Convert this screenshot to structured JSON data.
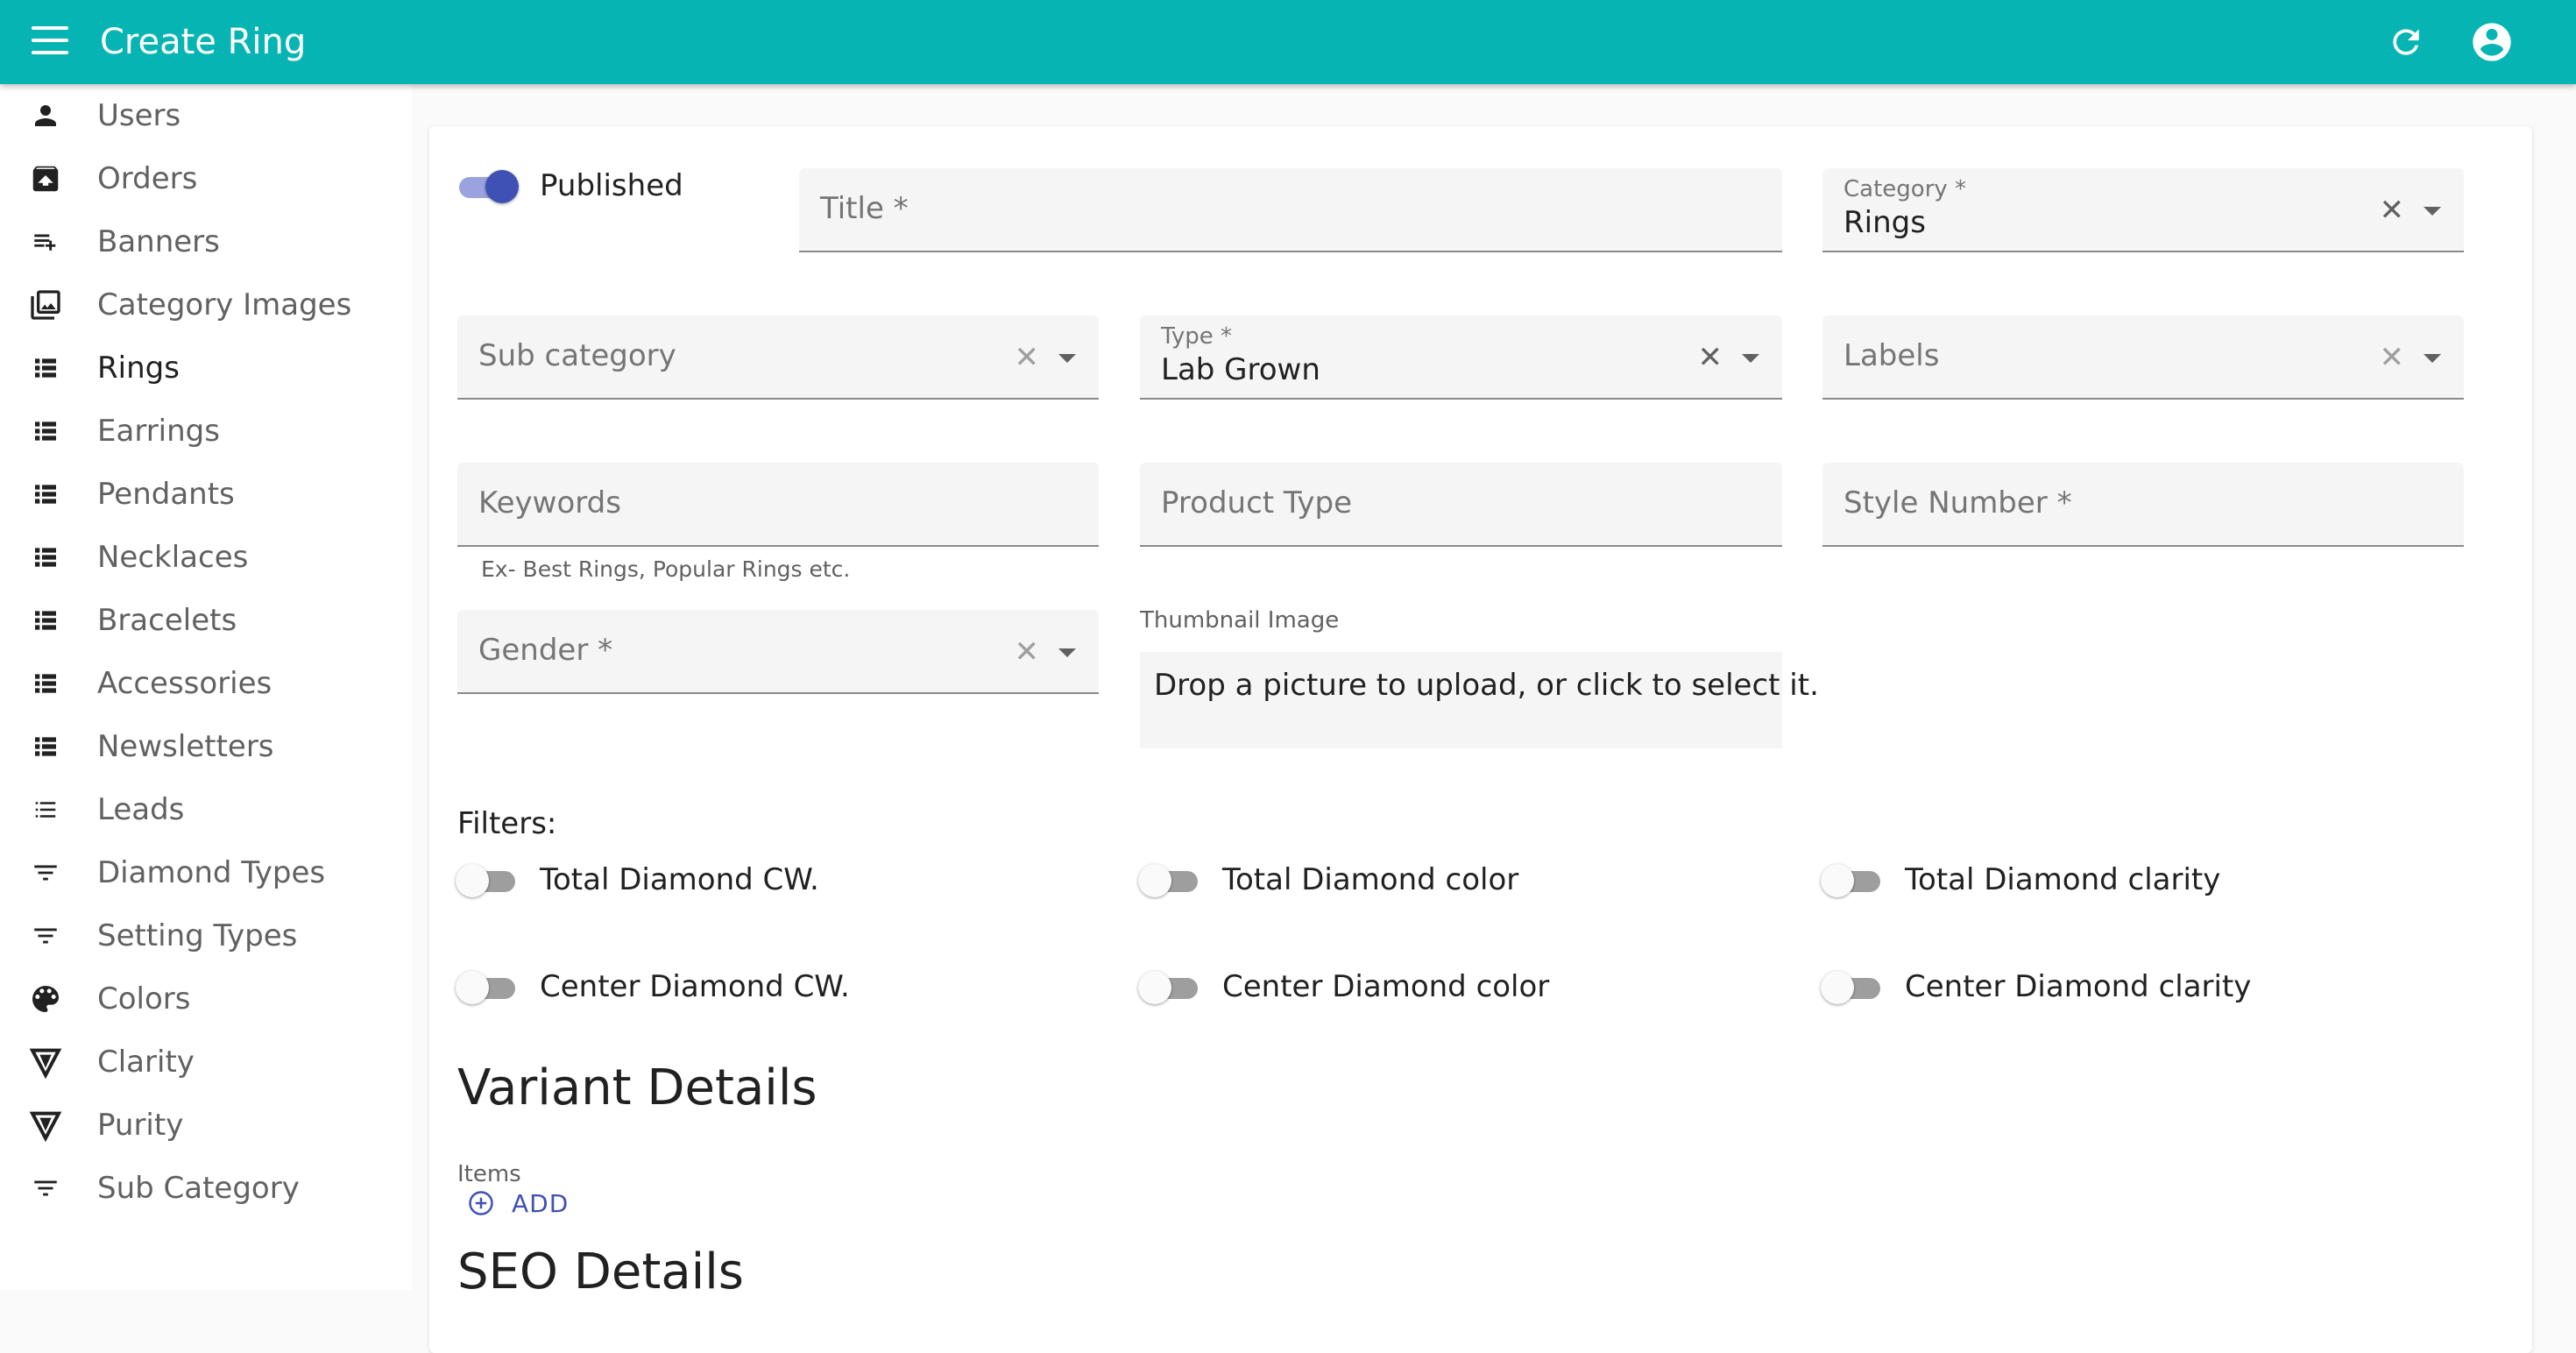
{
  "appbar": {
    "title": "Create Ring",
    "icons": [
      "menu-icon",
      "refresh-icon",
      "account-circle-icon"
    ],
    "color": "#06b5b3"
  },
  "sidebar": {
    "items": [
      {
        "label": "Users",
        "icon": "person-icon"
      },
      {
        "label": "Orders",
        "icon": "archive-icon"
      },
      {
        "label": "Banners",
        "icon": "playlist-add-icon"
      },
      {
        "label": "Category Images",
        "icon": "photo-library-icon"
      },
      {
        "label": "Rings",
        "icon": "view-list-icon",
        "active": true
      },
      {
        "label": "Earrings",
        "icon": "view-list-icon"
      },
      {
        "label": "Pendants",
        "icon": "view-list-icon"
      },
      {
        "label": "Necklaces",
        "icon": "view-list-icon"
      },
      {
        "label": "Bracelets",
        "icon": "view-list-icon"
      },
      {
        "label": "Accessories",
        "icon": "view-list-icon"
      },
      {
        "label": "Newsletters",
        "icon": "view-list-icon"
      },
      {
        "label": "Leads",
        "icon": "list-icon"
      },
      {
        "label": "Diamond Types",
        "icon": "filter-list-icon"
      },
      {
        "label": "Setting Types",
        "icon": "filter-list-icon"
      },
      {
        "label": "Colors",
        "icon": "palette-icon"
      },
      {
        "label": "Clarity",
        "icon": "vignette-triangle-icon"
      },
      {
        "label": "Purity",
        "icon": "vignette-triangle-icon"
      },
      {
        "label": "Sub Category",
        "icon": "filter-list-icon"
      }
    ]
  },
  "form": {
    "published": {
      "label": "Published",
      "on": true
    },
    "title": {
      "placeholder": "Title *"
    },
    "category": {
      "label": "Category *",
      "value": "Rings"
    },
    "sub_category": {
      "placeholder": "Sub category"
    },
    "type": {
      "label": "Type *",
      "value": "Lab Grown"
    },
    "labels": {
      "placeholder": "Labels"
    },
    "keywords": {
      "placeholder": "Keywords",
      "helper": "Ex- Best Rings, Popular Rings etc."
    },
    "product_type": {
      "placeholder": "Product Type"
    },
    "style_number": {
      "placeholder": "Style Number *"
    },
    "gender": {
      "placeholder": "Gender *"
    },
    "thumbnail": {
      "label": "Thumbnail Image",
      "dropzone_text": "Drop a picture to upload, or click to select it."
    },
    "clear_symbol": "✕",
    "filters": {
      "heading": "Filters:",
      "toggles": [
        {
          "label": "Total Diamond CW.",
          "on": false
        },
        {
          "label": "Total Diamond color",
          "on": false
        },
        {
          "label": "Total Diamond clarity",
          "on": false
        },
        {
          "label": "Center Diamond CW.",
          "on": false
        },
        {
          "label": "Center Diamond color",
          "on": false
        },
        {
          "label": "Center Diamond clarity",
          "on": false
        }
      ]
    },
    "variant_details": {
      "heading": "Variant Details",
      "items_label": "Items",
      "add_label": "ADD"
    },
    "seo_details": {
      "heading": "SEO Details"
    }
  },
  "accent_color": "#3f51b5"
}
